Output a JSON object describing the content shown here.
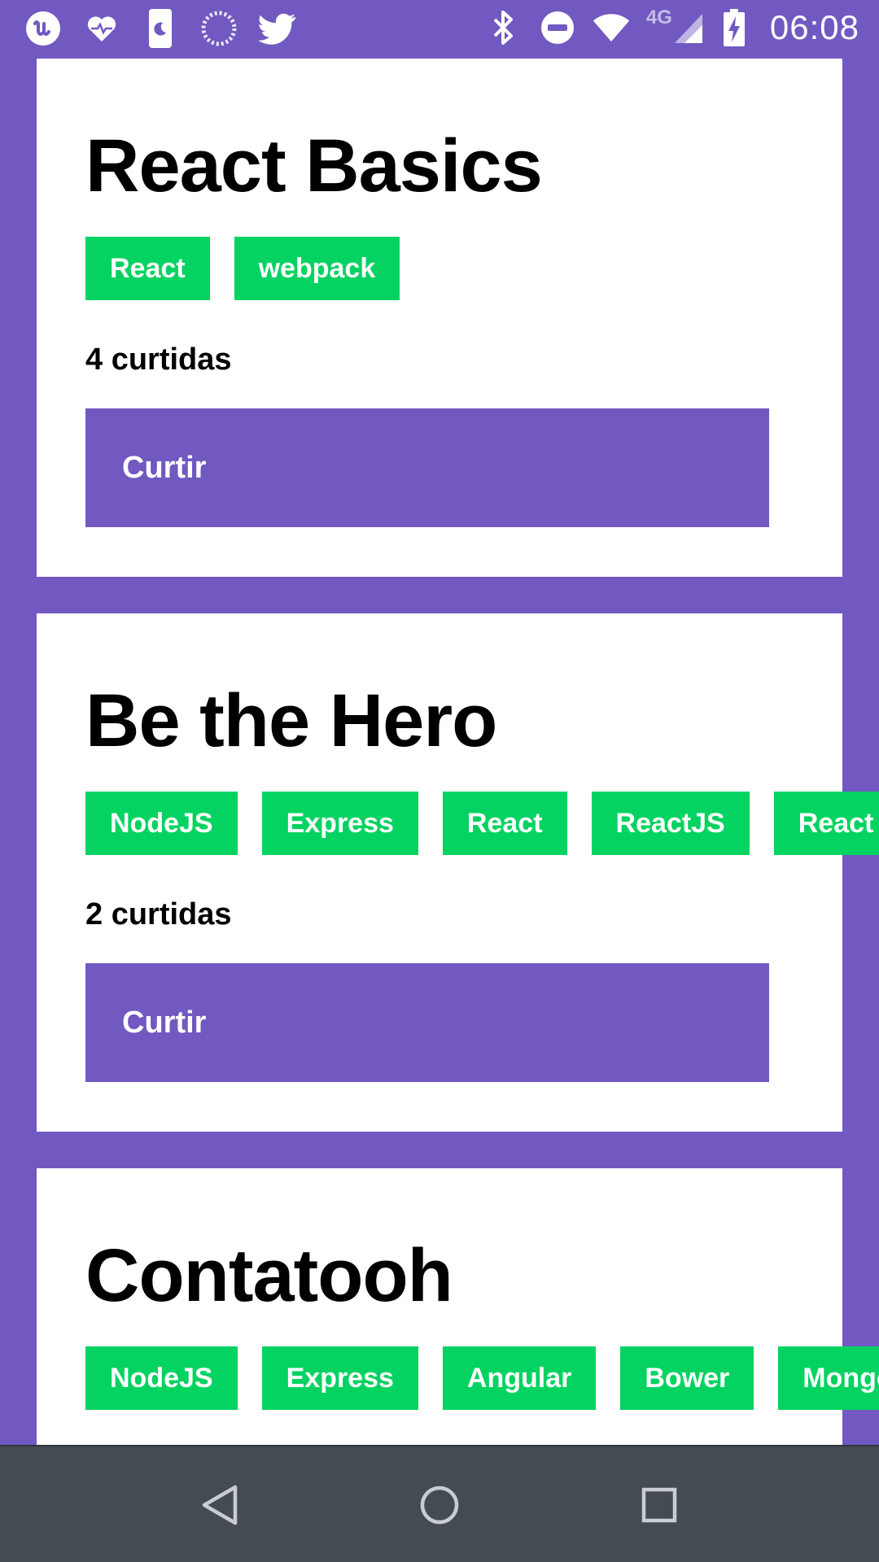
{
  "status_bar": {
    "time": "06:08",
    "network_label": "4G",
    "icons": [
      "app-u-icon",
      "heart-pulse-icon",
      "phone-moon-icon",
      "loading-circle-icon",
      "twitter-icon",
      "bluetooth-icon",
      "do-not-disturb-icon",
      "wifi-icon",
      "cell-signal-icon",
      "battery-charging-icon"
    ]
  },
  "repositories": [
    {
      "title": "React Basics",
      "techs": [
        "React",
        "webpack"
      ],
      "likes_text": "4 curtidas",
      "like_label": "Curtir"
    },
    {
      "title": "Be the Hero",
      "techs": [
        "NodeJS",
        "Express",
        "React",
        "ReactJS",
        "React N"
      ],
      "likes_text": "2 curtidas",
      "like_label": "Curtir"
    },
    {
      "title": "Contatooh",
      "techs": [
        "NodeJS",
        "Express",
        "Angular",
        "Bower",
        "Mongo"
      ],
      "likes_text": "",
      "like_label": ""
    }
  ],
  "nav_bar": {
    "icons": [
      "back-triangle-icon",
      "home-circle-icon",
      "recents-square-icon"
    ]
  },
  "colors": {
    "background": "#7159c1",
    "tag": "#04d361",
    "card": "#ffffff",
    "nav_bar": "#454b52"
  }
}
